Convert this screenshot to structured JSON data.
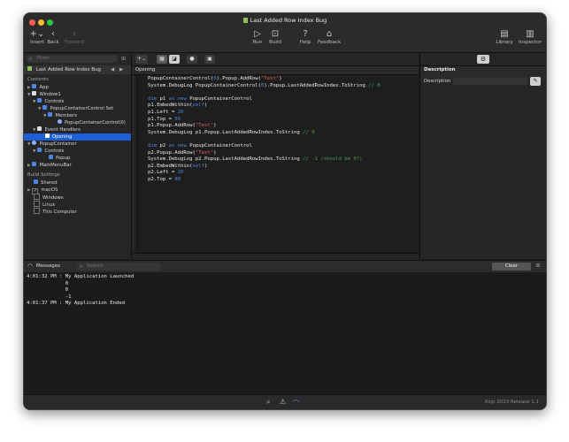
{
  "window": {
    "title": "Last Added Row Index Bug",
    "traffic_colors": [
      "#ff5f57",
      "#febc2e",
      "#28c840"
    ]
  },
  "toolbar": {
    "insert": "Insert",
    "back": "Back",
    "forward": "Forward",
    "run": "Run",
    "build": "Build",
    "help": "Help",
    "feedback": "Feedback",
    "library": "Library",
    "inspector": "Inspector"
  },
  "sidebar": {
    "filter_placeholder": "Filter",
    "project_name": "Last Added Row Index Bug",
    "contents_header": "Contents",
    "tree": [
      {
        "label": "App",
        "icon_color": "#4a86e8"
      },
      {
        "label": "Window1",
        "icon_color": "#dddddd"
      },
      {
        "label": "Controls",
        "icon_color": "#4a86e8"
      },
      {
        "label": "PopupContainerControl Set",
        "icon_color": "#4a86e8"
      },
      {
        "label": "Members",
        "icon_color": "#4a86e8"
      },
      {
        "label": "PopupContainerControl(0)",
        "icon_color": "#8fb4ff"
      },
      {
        "label": "Event Handlers",
        "icon_color": "#dddddd"
      },
      {
        "label": "Opening",
        "icon_color": "#ffffff"
      },
      {
        "label": "PopupContainer",
        "icon_color": "#8fb4ff"
      },
      {
        "label": "Controls",
        "icon_color": "#4a86e8"
      },
      {
        "label": "Popup",
        "icon_color": "#4a86e8"
      },
      {
        "label": "MainMenuBar",
        "icon_color": "#4a86e8"
      }
    ],
    "build_header": "Build Settings",
    "build": [
      {
        "label": "Shared",
        "checked": false
      },
      {
        "label": "macOS",
        "checked": true
      },
      {
        "label": "Windows",
        "checked": false
      },
      {
        "label": "Linux",
        "checked": false
      },
      {
        "label": "This Computer",
        "checked": false
      }
    ]
  },
  "editor": {
    "tab": "Opening",
    "code": [
      [
        [
          "PopupContainerControl(",
          ""
        ],
        [
          "0",
          "num"
        ],
        [
          ").Popup.AddRow(",
          ""
        ],
        [
          "\"Test\"",
          "str"
        ],
        [
          ")",
          ""
        ]
      ],
      [
        [
          "System.DebugLog PopupContainerControl(",
          ""
        ],
        [
          "0",
          "num"
        ],
        [
          ").Popup.LastAddedRowIndex.ToString ",
          ""
        ],
        [
          "// 0",
          "cmt"
        ]
      ],
      [],
      [
        [
          "dim",
          "kw"
        ],
        [
          " p1 ",
          ""
        ],
        [
          "as",
          "kw"
        ],
        [
          " ",
          ""
        ],
        [
          "new",
          "kw"
        ],
        [
          " PopupContainerControl",
          ""
        ]
      ],
      [
        [
          "p1.EmbedWithin(",
          ""
        ],
        [
          "self",
          "kw"
        ],
        [
          ")",
          ""
        ]
      ],
      [
        [
          "p1.Left = ",
          ""
        ],
        [
          "20",
          "num"
        ]
      ],
      [
        [
          "p1.Top = ",
          ""
        ],
        [
          "50",
          "num"
        ]
      ],
      [
        [
          "p1.Popup.AddRow(",
          ""
        ],
        [
          "\"Test\"",
          "str"
        ],
        [
          ")",
          ""
        ]
      ],
      [
        [
          "System.DebugLog p1.Popup.LastAddedRowIndex.ToString ",
          ""
        ],
        [
          "// 0",
          "cmt"
        ]
      ],
      [],
      [
        [
          "dim",
          "kw"
        ],
        [
          " p2 ",
          ""
        ],
        [
          "as",
          "kw"
        ],
        [
          " ",
          ""
        ],
        [
          "new",
          "kw"
        ],
        [
          " PopupContainerControl",
          ""
        ]
      ],
      [
        [
          "p2.Popup.AddRow(",
          ""
        ],
        [
          "\"Test\"",
          "str"
        ],
        [
          ")",
          ""
        ]
      ],
      [
        [
          "System.DebugLog p2.Popup.LastAddedRowIndex.ToString ",
          ""
        ],
        [
          "// -1 (should be 0?)",
          "cmt"
        ]
      ],
      [
        [
          "p2.EmbedWithin(",
          ""
        ],
        [
          "self",
          "kw"
        ],
        [
          ")",
          ""
        ]
      ],
      [
        [
          "p2.Left = ",
          ""
        ],
        [
          "20",
          "num"
        ]
      ],
      [
        [
          "p2.Top = ",
          ""
        ],
        [
          "80",
          "num"
        ]
      ]
    ]
  },
  "inspector": {
    "section": "Description",
    "field_label": "Description",
    "field_value": ""
  },
  "messages": {
    "title": "Messages",
    "search_placeholder": "Search",
    "clear": "Clear",
    "lines": [
      "4:01:32 PM : My Application Launched",
      "             0",
      "             0",
      "             -1",
      "4:01:37 PM : My Application Ended"
    ]
  },
  "status": {
    "version": "Xojo 2023 Release 1.1"
  }
}
